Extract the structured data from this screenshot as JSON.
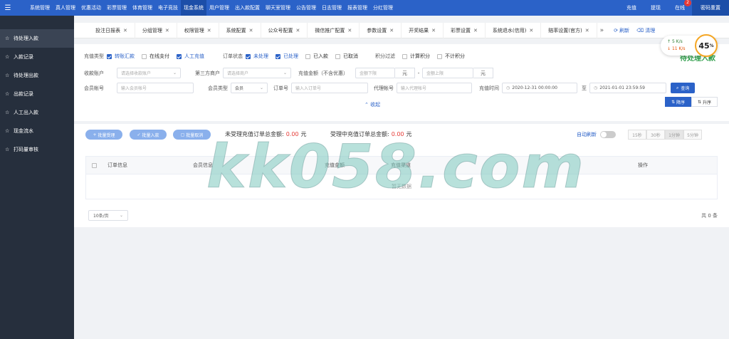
{
  "topnav": {
    "menu": [
      "系统管理",
      "真人管理",
      "优惠活动",
      "彩票管理",
      "体育管理",
      "电子竞技",
      "现金系统",
      "用户管理",
      "出入款配置",
      "聊天室管理",
      "公告管理",
      "日志管理",
      "报表管理",
      "分红管理"
    ],
    "active_index": 6,
    "right": {
      "recharge": "充值",
      "withdraw": "提现",
      "online": "在线",
      "online_badge": "2",
      "reset_password": "密码重置"
    }
  },
  "sidebar": {
    "items": [
      {
        "label": "待处理入款",
        "icon": "star-icon",
        "active": true
      },
      {
        "label": "入款记录",
        "icon": "star-icon"
      },
      {
        "label": "待处理出款",
        "icon": "star-icon"
      },
      {
        "label": "出款记录",
        "icon": "star-icon"
      },
      {
        "label": "人工出入款",
        "icon": "star-icon"
      },
      {
        "label": "现金流水",
        "icon": "star-icon"
      },
      {
        "label": "打码量审核",
        "icon": "star-icon"
      }
    ]
  },
  "tabs": {
    "items": [
      "投注日报表",
      "分组管理",
      "权限管理",
      "系统配置",
      "公众号配置",
      "微信推广配置",
      "参数设置",
      "开奖结果",
      "彩票设置",
      "系统退水(信用)",
      "赔率设置(官方)"
    ],
    "more": "»",
    "refresh": "刷新",
    "clean": "清理"
  },
  "speed": {
    "up": "5  K/s",
    "down": "11  K/s",
    "percent": "45",
    "percent_unit": "%"
  },
  "page_title": "待处理入款",
  "filters": {
    "recharge_type": {
      "label": "充值类型",
      "options": [
        {
          "label": "转账汇款",
          "checked": true
        },
        {
          "label": "在线支付",
          "checked": false
        },
        {
          "label": "人工充值",
          "checked": true
        }
      ]
    },
    "order_status": {
      "label": "订单状态",
      "options": [
        {
          "label": "未处理",
          "checked": true
        },
        {
          "label": "已处理",
          "checked": true
        },
        {
          "label": "已入款",
          "checked": false
        },
        {
          "label": "已取消",
          "checked": false
        }
      ]
    },
    "points": {
      "label": "积分过滤",
      "options": [
        {
          "label": "计算积分",
          "checked": false
        },
        {
          "label": "不计积分",
          "checked": false
        }
      ]
    },
    "receive_account": {
      "label": "收款账户",
      "placeholder": "请选择收款账户"
    },
    "third_party": {
      "label": "第三方商户",
      "placeholder": "请选择商户"
    },
    "amount": {
      "label": "充值金额（不含优惠）",
      "min_placeholder": "金额下限",
      "max_placeholder": "金额上限",
      "unit": "元",
      "dash": "-"
    },
    "member_account": {
      "label": "会员帐号",
      "placeholder": "输入会员帐号"
    },
    "member_type": {
      "label": "会员类型",
      "value": "会员"
    },
    "order_no": {
      "label": "订单号",
      "placeholder": "输入入订单号"
    },
    "agent_account": {
      "label": "代理帐号",
      "placeholder": "输入代理帐号"
    },
    "recharge_time": {
      "label": "充值时间",
      "start": "2020-12-31 00:00:00",
      "to": "至",
      "end": "2021-01-01 23:59:59"
    },
    "query_button": "查询",
    "collapse": "收起",
    "sort_desc": "降序",
    "sort_asc": "升序"
  },
  "actions": {
    "batch_accept": "批量受理",
    "batch_deposit": "批量入款",
    "batch_cancel": "批量取消"
  },
  "summary": {
    "unaccepted_label": "未受理充值订单总金额:",
    "unaccepted_value": "0.00",
    "unaccepted_unit": "元",
    "accepting_label": "受理中充值订单总金额:",
    "accepting_value": "0.00",
    "accepting_unit": "元"
  },
  "auto_refresh": {
    "label": "自动刷新",
    "intervals": [
      "15秒",
      "30秒",
      "1分钟",
      "5分钟"
    ],
    "selected_index": 2
  },
  "table": {
    "columns": [
      "订单信息",
      "会员信息",
      "充值金额",
      "充值渠道",
      "操作"
    ],
    "empty_text": "暂无数据"
  },
  "pagination": {
    "page_size": "10条/页",
    "total": "共 0 条"
  },
  "watermark": "kk058.com"
}
